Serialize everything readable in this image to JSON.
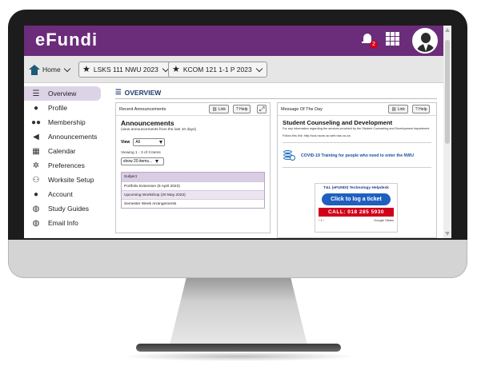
{
  "header": {
    "logo_text": "eFundi",
    "notification_count": "2",
    "brand_color": "#6b2c7a"
  },
  "sitebar": {
    "home_label": "Home",
    "sites": [
      {
        "label": "LSKS 111 NWU 2023"
      },
      {
        "label": "KCOM 121 1-1 P 2023"
      }
    ]
  },
  "sidebar": {
    "items": [
      {
        "label": "Overview",
        "icon": "list-icon",
        "active": true
      },
      {
        "label": "Profile",
        "icon": "user-icon"
      },
      {
        "label": "Membership",
        "icon": "group-icon"
      },
      {
        "label": "Announcements",
        "icon": "megaphone-icon"
      },
      {
        "label": "Calendar",
        "icon": "calendar-icon"
      },
      {
        "label": "Preferences",
        "icon": "gear-icon"
      },
      {
        "label": "Worksite Setup",
        "icon": "sitemap-icon"
      },
      {
        "label": "Account",
        "icon": "user-icon"
      },
      {
        "label": "Study Guides",
        "icon": "globe-icon"
      },
      {
        "label": "Email Info",
        "icon": "globe-icon"
      }
    ]
  },
  "main": {
    "title": "OVERVIEW",
    "announcements_panel": {
      "header": "Recent Announcements",
      "link_label": "Link",
      "help_label": "Help",
      "title": "Announcements",
      "subtitle": "(view announcements from the last 10 days)",
      "view_label": "View",
      "view_value": "All",
      "viewing_text": "Viewing 1 - 3 of 3 items",
      "show_value": "show 20 items...",
      "column_header": "Subject",
      "rows": [
        "Portfolio Extension (9 April 2023)",
        "Upcoming Workshop (20 May 2023)",
        "Semester Week Arrangements"
      ]
    },
    "motd_panel": {
      "header": "Message Of The Day",
      "link_label": "Link",
      "help_label": "Help",
      "title": "Student Counseling and Development",
      "subtitle": "For any information regarding the services provided by the Student Counseling and Development department",
      "link_text": "Follow this link: http://scd-nw.an.ac.web.nwu.ac.za",
      "covid_text": "COVID-19 Training for people who need to enter the NWU",
      "helpdesk_title": "T&L (eFUNDI) Technology Helpdesk",
      "helpdesk_button": "Click to log a ticket",
      "helpdesk_call": "CALL: 018 285 5930",
      "slides_page": "1",
      "slides_label": "Google Slides"
    }
  }
}
